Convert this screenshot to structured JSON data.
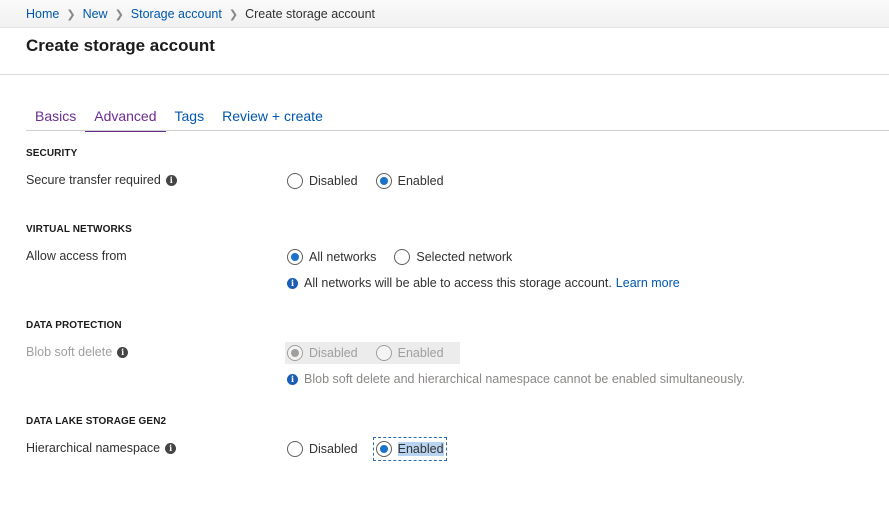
{
  "breadcrumb": {
    "items": [
      "Home",
      "New",
      "Storage account"
    ],
    "current": "Create storage account"
  },
  "page": {
    "title": "Create storage account"
  },
  "tabs": [
    {
      "label": "Basics",
      "active": false
    },
    {
      "label": "Advanced",
      "active": true
    },
    {
      "label": "Tags",
      "active": false
    },
    {
      "label": "Review + create",
      "active": false
    }
  ],
  "sections": {
    "security": {
      "title": "SECURITY",
      "label": "Secure transfer required",
      "options": [
        "Disabled",
        "Enabled"
      ],
      "selected": "Enabled"
    },
    "virtual_networks": {
      "title": "VIRTUAL NETWORKS",
      "label": "Allow access from",
      "options": [
        "All networks",
        "Selected network"
      ],
      "selected": "All networks",
      "note": "All networks will be able to access this storage account.",
      "note_link": "Learn more"
    },
    "data_protection": {
      "title": "DATA PROTECTION",
      "label": "Blob soft delete",
      "options": [
        "Disabled",
        "Enabled"
      ],
      "selected": "Disabled",
      "disabled": true,
      "note": "Blob soft delete and hierarchical namespace cannot be enabled simultaneously."
    },
    "data_lake": {
      "title": "DATA LAKE STORAGE GEN2",
      "label": "Hierarchical namespace",
      "options": [
        "Disabled",
        "Enabled"
      ],
      "selected": "Enabled"
    }
  },
  "icons": {
    "info": "info-icon",
    "breadcrumb_separator": "chevron-right-icon"
  },
  "colors": {
    "accent": "#1a73c8",
    "tab_active": "#6b2c91",
    "link": "#0058ad"
  }
}
